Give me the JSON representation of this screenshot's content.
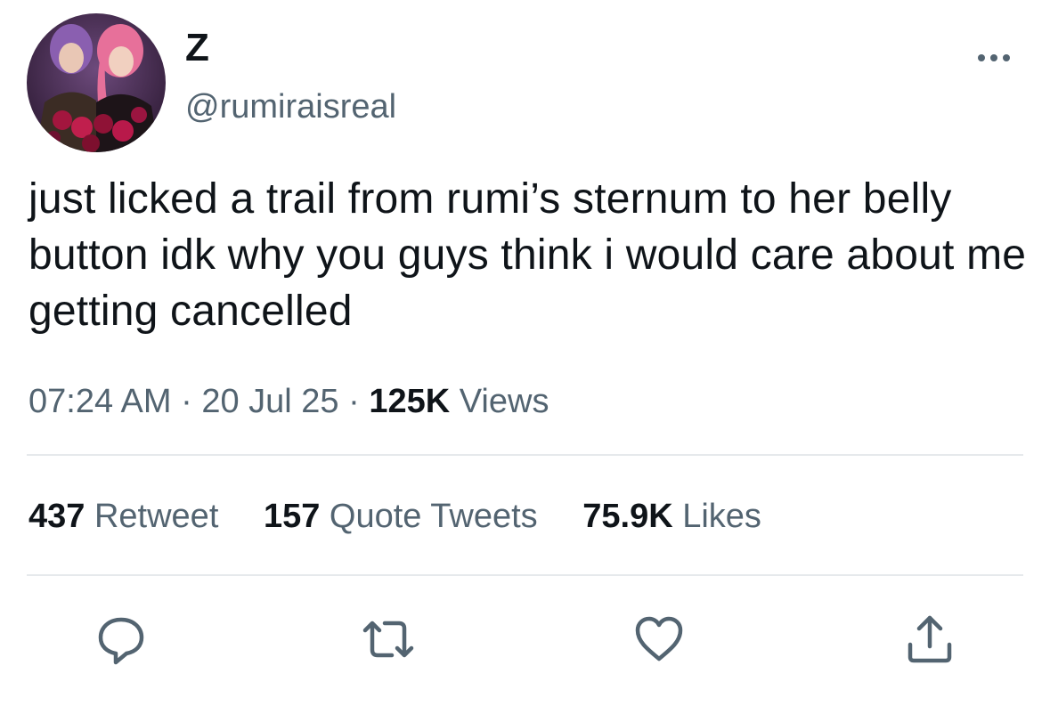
{
  "tweet": {
    "display_name": "Z",
    "handle": "@rumiraisreal",
    "text": "just licked a trail from rumi’s sternum to her belly button idk why you guys think i would care about me getting cancelled",
    "time": "07:24 AM",
    "separator": "·",
    "date": "20 Jul 25",
    "views_count": "125K",
    "views_label": "Views"
  },
  "stats": {
    "retweets_count": "437",
    "retweets_label": "Retweet",
    "quotes_count": "157",
    "quotes_label": "Quote Tweets",
    "likes_count": "75.9K",
    "likes_label": "Likes"
  },
  "icons": {
    "more": "more-dots-icon",
    "reply": "reply-bubble-icon",
    "retweet": "retweet-arrows-icon",
    "like": "heart-icon",
    "share": "share-upload-icon"
  },
  "colors": {
    "primary_text": "#0f1419",
    "secondary_text": "#536471",
    "divider": "#e6e9ec",
    "icon": "#536471"
  }
}
